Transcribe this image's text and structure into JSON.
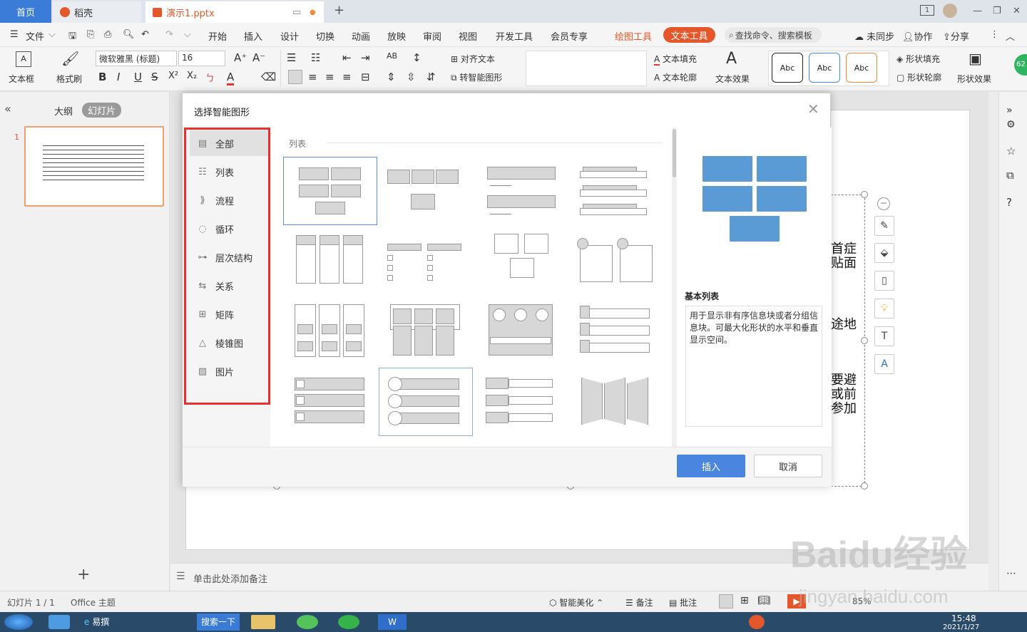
{
  "tabs": {
    "home": "首页",
    "wps": "稻壳",
    "doc": "演示1.pptx"
  },
  "window": {
    "badge": "1"
  },
  "menu": {
    "file": "文件",
    "items": [
      "开始",
      "插入",
      "设计",
      "切换",
      "动画",
      "放映",
      "审阅",
      "视图",
      "开发工具",
      "会员专享"
    ],
    "drawing_tools": "绘图工具",
    "text_tools": "文本工具",
    "search": "查找命令、搜索模板",
    "unsynced": "未同步",
    "collab": "协作",
    "share": "分享"
  },
  "ribbon": {
    "textbox": "文本框",
    "format_painter": "格式刷",
    "font_name": "微软雅黑 (标题)",
    "font_size": "16",
    "align_text": "对齐文本",
    "smartart": "转智能图形",
    "text_fill": "文本填充",
    "text_outline": "文本轮廓",
    "text_effect": "文本效果",
    "style_letter": "A",
    "abc": "Abc",
    "shape_fill": "形状填充",
    "shape_outline": "形状轮廓",
    "shape_effect": "形状效果",
    "bold": "B",
    "italic": "I",
    "underline": "U",
    "strike": "S",
    "sup": "X²",
    "sub": "X₂",
    "zoom_badge": "62"
  },
  "left_panel": {
    "outline": "大纲",
    "slides": "幻灯片",
    "slide_number": "1"
  },
  "slide_text": [
    "首症",
    "贴面",
    "途地",
    "要避",
    "或前",
    "参加"
  ],
  "dialog": {
    "title": "选择智能图形",
    "categories": [
      {
        "label": "全部",
        "icon": "all-icon"
      },
      {
        "label": "列表",
        "icon": "list-icon"
      },
      {
        "label": "流程",
        "icon": "process-icon"
      },
      {
        "label": "循环",
        "icon": "cycle-icon"
      },
      {
        "label": "层次结构",
        "icon": "hierarchy-icon"
      },
      {
        "label": "关系",
        "icon": "relationship-icon"
      },
      {
        "label": "矩阵",
        "icon": "matrix-icon"
      },
      {
        "label": "棱锥图",
        "icon": "pyramid-icon"
      },
      {
        "label": "图片",
        "icon": "picture-icon"
      }
    ],
    "section": "列表",
    "preview_title": "基本列表",
    "preview_desc": "用于显示非有序信息块或者分组信息块。可最大化形状的水平和垂直显示空间。",
    "insert": "插入",
    "cancel": "取消"
  },
  "notes_placeholder": "单击此处添加备注",
  "status": {
    "slide_count": "幻灯片 1 / 1",
    "theme": "Office 主题",
    "beautify": "智能美化",
    "notes": "备注",
    "comments": "批注",
    "zoom": "85%"
  },
  "taskbar": {
    "app1": "易撰",
    "search": "搜索一下",
    "time": "15:48",
    "date": "2021/1/27"
  },
  "watermark": {
    "brand": "Baidu经验",
    "url": "jingyan.baidu.com"
  },
  "colors": {
    "accent_blue": "#3b7cd8",
    "brand_orange": "#e4572a",
    "highlight_red": "#e8312f",
    "preview_blue": "#5b9bd5"
  }
}
